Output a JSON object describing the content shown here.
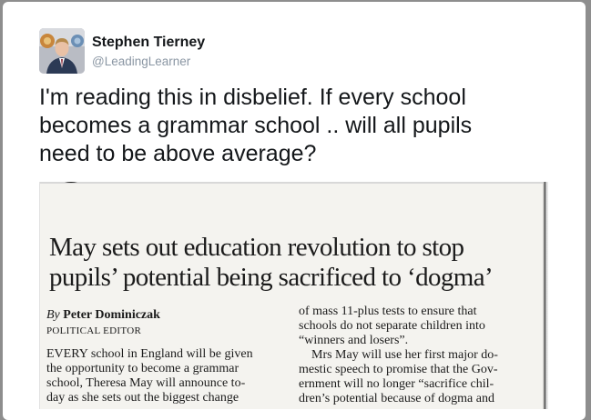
{
  "tweet": {
    "display_name": "Stephen Tierney",
    "handle": "@LeadingLearner",
    "text_lines": [
      "I'm reading this in disbelief. If every school",
      "becomes a grammar school .. will all pupils",
      "need to be above average?"
    ]
  },
  "article": {
    "headline_lines": [
      "May sets out education revolution to stop",
      "pupils’ potential being sacrificed to ‘dogma’"
    ],
    "byline_prefix": "By",
    "byline_name": "Peter Dominiczak",
    "byline_role": "POLITICAL EDITOR",
    "left_column_lines": [
      "EVERY school in England will be given",
      "the opportunity to become a grammar",
      "school, Theresa May will announce to-",
      "day as she sets out the biggest change"
    ],
    "right_column_lines": [
      "of mass 11-plus tests to ensure that",
      "schools do not separate children into",
      "“winners and losers”.",
      "    Mrs May will use her first major do-",
      "mestic speech to promise that the Gov-",
      "ernment will no longer “sacrifice chil-",
      "dren’s potential because of dogma and"
    ]
  }
}
